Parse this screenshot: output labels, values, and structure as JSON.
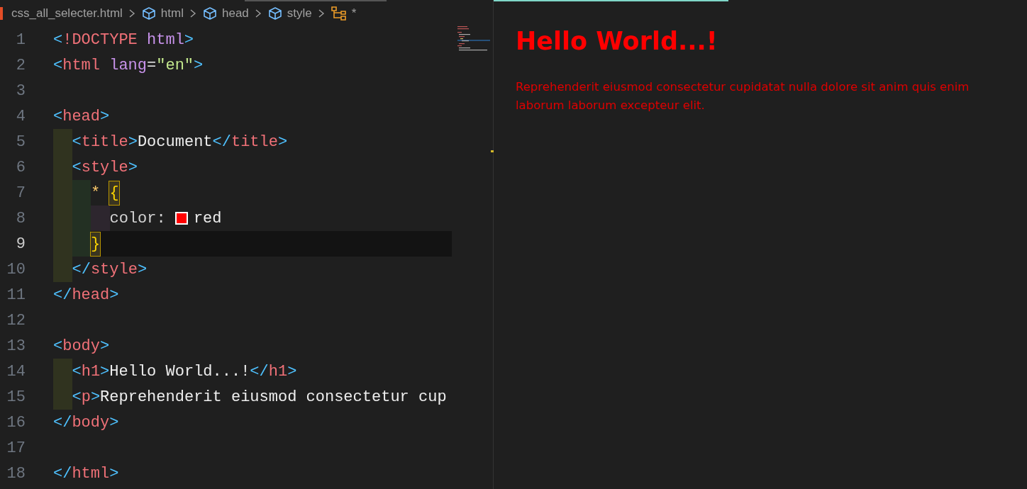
{
  "breadcrumbs": [
    {
      "text": "css_all_selecter.html",
      "kind": "file"
    },
    {
      "text": "html",
      "kind": "element"
    },
    {
      "text": "head",
      "kind": "element"
    },
    {
      "text": "style",
      "kind": "element"
    },
    {
      "text": "*",
      "kind": "selector"
    }
  ],
  "editor": {
    "lines": [
      {
        "number": "1",
        "current": false,
        "tokens": [
          {
            "kind": "punct",
            "text": "<"
          },
          {
            "kind": "tag",
            "text": "!DOCTYPE "
          },
          {
            "kind": "attr",
            "text": "html"
          },
          {
            "kind": "punct",
            "text": ">"
          }
        ]
      },
      {
        "number": "2",
        "current": false,
        "tokens": [
          {
            "kind": "punct",
            "text": "<"
          },
          {
            "kind": "tag",
            "text": "html "
          },
          {
            "kind": "attr",
            "text": "lang"
          },
          {
            "kind": "plain",
            "text": "="
          },
          {
            "kind": "string",
            "text": "\"en\""
          },
          {
            "kind": "punct",
            "text": ">"
          }
        ]
      },
      {
        "number": "3",
        "current": false
      },
      {
        "number": "4",
        "current": false,
        "tokens": [
          {
            "kind": "punct",
            "text": "<"
          },
          {
            "kind": "tag",
            "text": "head"
          },
          {
            "kind": "punct",
            "text": ">"
          }
        ],
        "children": [
          {
            "number": "5",
            "current": false,
            "tokens": [
              {
                "kind": "punct",
                "text": "<"
              },
              {
                "kind": "tag",
                "text": "title"
              },
              {
                "kind": "punct",
                "text": ">"
              },
              {
                "kind": "plain",
                "text": "Document"
              },
              {
                "kind": "punct",
                "text": "</"
              },
              {
                "kind": "tag",
                "text": "title"
              },
              {
                "kind": "punct",
                "text": ">"
              }
            ]
          },
          {
            "number": "6",
            "current": false,
            "tokens": [
              {
                "kind": "punct",
                "text": "<"
              },
              {
                "kind": "tag",
                "text": "style"
              },
              {
                "kind": "punct",
                "text": ">"
              }
            ],
            "children": [
              {
                "number": "7",
                "current": false,
                "tokens": [
                  {
                    "kind": "selector",
                    "text": "* "
                  },
                  {
                    "kind": "brace",
                    "text": "{",
                    "matched": true
                  }
                ],
                "children": [
                  {
                    "number": "8",
                    "current": false,
                    "tokens": [
                      {
                        "kind": "prop",
                        "text": "color: "
                      },
                      {
                        "kind": "swatch",
                        "color": "#ff0000"
                      },
                      {
                        "kind": "plain",
                        "text": "red"
                      }
                    ]
                  }
                ]
              },
              {
                "number": "9",
                "current": true,
                "tokens": [
                  {
                    "kind": "brace",
                    "text": "}",
                    "matched": true
                  }
                ]
              }
            ]
          },
          {
            "number": "10",
            "current": false,
            "tokens": [
              {
                "kind": "punct",
                "text": "</"
              },
              {
                "kind": "tag",
                "text": "style"
              },
              {
                "kind": "punct",
                "text": ">"
              }
            ]
          }
        ]
      },
      {
        "number": "11",
        "current": false,
        "tokens": [
          {
            "kind": "punct",
            "text": "</"
          },
          {
            "kind": "tag",
            "text": "head"
          },
          {
            "kind": "punct",
            "text": ">"
          }
        ]
      },
      {
        "number": "12",
        "current": false
      },
      {
        "number": "13",
        "current": false,
        "tokens": [
          {
            "kind": "punct",
            "text": "<"
          },
          {
            "kind": "tag",
            "text": "body"
          },
          {
            "kind": "punct",
            "text": ">"
          }
        ],
        "children": [
          {
            "number": "14",
            "current": false,
            "tokens": [
              {
                "kind": "punct",
                "text": "<"
              },
              {
                "kind": "tag",
                "text": "h1"
              },
              {
                "kind": "punct",
                "text": ">"
              },
              {
                "kind": "plain",
                "text": "Hello World...!"
              },
              {
                "kind": "punct",
                "text": "</"
              },
              {
                "kind": "tag",
                "text": "h1"
              },
              {
                "kind": "punct",
                "text": ">"
              }
            ]
          },
          {
            "number": "15",
            "current": false,
            "tokens": [
              {
                "kind": "punct",
                "text": "<"
              },
              {
                "kind": "tag",
                "text": "p"
              },
              {
                "kind": "punct",
                "text": ">"
              },
              {
                "kind": "plain",
                "text": "Reprehenderit eiusmod consectetur cup"
              }
            ]
          }
        ]
      },
      {
        "number": "16",
        "current": false,
        "tokens": [
          {
            "kind": "punct",
            "text": "</"
          },
          {
            "kind": "tag",
            "text": "body"
          },
          {
            "kind": "punct",
            "text": ">"
          }
        ]
      },
      {
        "number": "17",
        "current": false
      },
      {
        "number": "18",
        "current": false,
        "tokens": [
          {
            "kind": "punct",
            "text": "</"
          },
          {
            "kind": "tag",
            "text": "html"
          },
          {
            "kind": "punct",
            "text": ">"
          }
        ]
      }
    ]
  },
  "preview": {
    "heading": "Hello World...!",
    "paragraph": "Reprehenderit eiusmod consectetur cupidatat nulla dolore sit anim quis enim laborum laborum excepteur elit."
  }
}
